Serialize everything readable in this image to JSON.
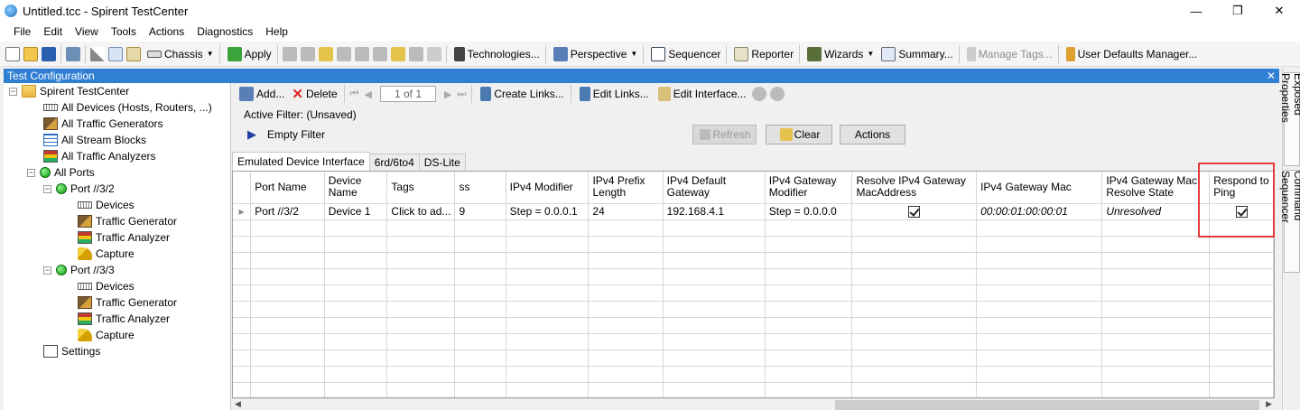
{
  "window": {
    "title": "Untitled.tcc - Spirent TestCenter",
    "minimize": "—",
    "restore": "❐",
    "close": "✕"
  },
  "menu": [
    "File",
    "Edit",
    "View",
    "Tools",
    "Actions",
    "Diagnostics",
    "Help"
  ],
  "toolbar": {
    "chassis": "Chassis",
    "apply": "Apply",
    "technologies": "Technologies...",
    "perspective": "Perspective",
    "sequencer": "Sequencer",
    "reporter": "Reporter",
    "wizards": "Wizards",
    "summary": "Summary...",
    "manage_tags": "Manage Tags...",
    "user_defaults": "User Defaults Manager..."
  },
  "panel": {
    "title": "Test Configuration",
    "close": "✕"
  },
  "tree": {
    "root": "Spirent TestCenter",
    "all_devices": "All Devices (Hosts, Routers, ...)",
    "all_traffic_generators": "All Traffic Generators",
    "all_stream_blocks": "All Stream Blocks",
    "all_traffic_analyzers": "All Traffic Analyzers",
    "all_ports": "All Ports",
    "ports": [
      {
        "name": "Port //3/2",
        "children": [
          "Devices",
          "Traffic Generator",
          "Traffic Analyzer",
          "Capture"
        ]
      },
      {
        "name": "Port //3/3",
        "children": [
          "Devices",
          "Traffic Generator",
          "Traffic Analyzer",
          "Capture"
        ]
      }
    ],
    "settings": "Settings"
  },
  "subtoolbar": {
    "add": "Add...",
    "delete": "Delete",
    "page": "1 of 1",
    "create_links": "Create Links...",
    "edit_links": "Edit Links...",
    "edit_interface": "Edit Interface..."
  },
  "filter": {
    "active_label": "Active Filter:  (Unsaved)",
    "empty_filter": "Empty Filter",
    "refresh": "Refresh",
    "clear": "Clear",
    "actions": "Actions"
  },
  "tabs": [
    "Emulated Device Interface",
    "6rd/6to4",
    "DS-Lite"
  ],
  "grid": {
    "columns": [
      "Port Name",
      "Device Name",
      "Tags",
      "ss",
      "IPv4 Modifier",
      "IPv4 Prefix Length",
      "IPv4 Default Gateway",
      "IPv4 Gateway Modifier",
      "Resolve IPv4 Gateway MacAddress",
      "IPv4 Gateway Mac",
      "IPv4 Gateway Mac Resolve State",
      "Respond to Ping"
    ],
    "rows": [
      {
        "port": "Port //3/2",
        "device": "Device 1",
        "tags": "Click to ad...",
        "ss": "9",
        "ipv4_modifier": "Step = 0.0.0.1",
        "prefix": "24",
        "gateway": "192.168.4.1",
        "gw_modifier": "Step = 0.0.0.0",
        "resolve_gw_mac": true,
        "gw_mac": "00:00:01:00:00:01",
        "resolve_state": "Unresolved",
        "respond_to_ping": true
      }
    ],
    "empty_rows": 11
  },
  "side_tabs": [
    "Exposed Properties",
    "Command Sequencer"
  ]
}
